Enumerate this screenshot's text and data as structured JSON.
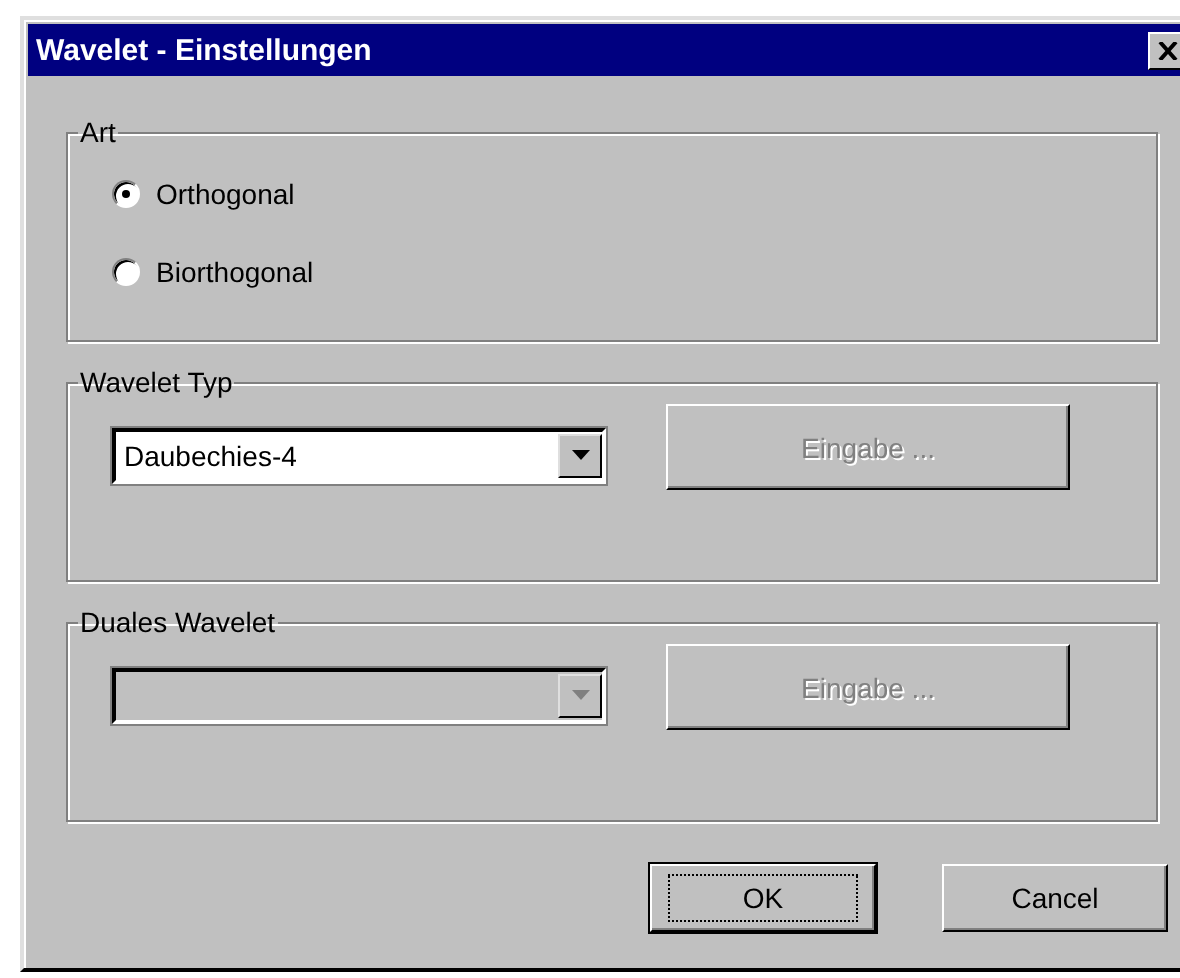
{
  "window": {
    "title": "Wavelet - Einstellungen"
  },
  "groups": [
    {
      "label": "Art",
      "kind": "radios",
      "options": [
        {
          "label": "Orthogonal",
          "selected": true
        },
        {
          "label": "Biorthogonal",
          "selected": false
        }
      ]
    },
    {
      "label": "Wavelet Typ",
      "kind": "combo",
      "value": "Daubechies-4",
      "disabled": false,
      "button": {
        "label": "Eingabe ...",
        "disabled": true
      }
    },
    {
      "label": "Duales Wavelet",
      "kind": "combo",
      "disabled": true,
      "button": {
        "label": "Eingabe ...",
        "disabled": true
      }
    }
  ],
  "buttons": [
    {
      "label": "OK",
      "default": true
    },
    {
      "label": "Cancel",
      "default": false
    }
  ]
}
